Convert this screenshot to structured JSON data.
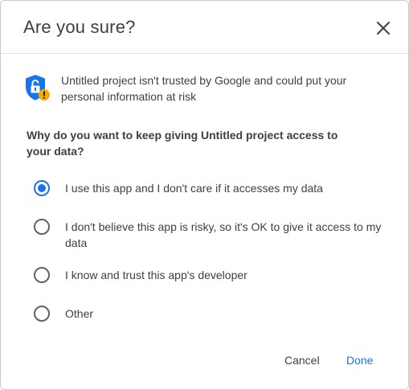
{
  "dialog": {
    "title": "Are you sure?",
    "warning": "Untitled project isn't trusted by Google and could put your personal information at risk",
    "question": "Why do you want to keep giving Untitled project access to your data?",
    "options": [
      {
        "label": "I use this app and I don't care if it accesses my data",
        "selected": true
      },
      {
        "label": "I don't believe this app is risky, so it's OK to give it access to my data",
        "selected": false
      },
      {
        "label": "I know and trust this app's developer",
        "selected": false
      },
      {
        "label": "Other",
        "selected": false
      }
    ],
    "buttons": {
      "cancel": "Cancel",
      "done": "Done"
    }
  },
  "icons": {
    "close": "close-icon",
    "shield": "shield-lock-warning-icon"
  },
  "colors": {
    "accent": "#1a73e8",
    "shield": "#1a73e8",
    "warning_badge": "#f9ab00",
    "text": "#3c4043",
    "radio_unselected": "#5f6368"
  }
}
